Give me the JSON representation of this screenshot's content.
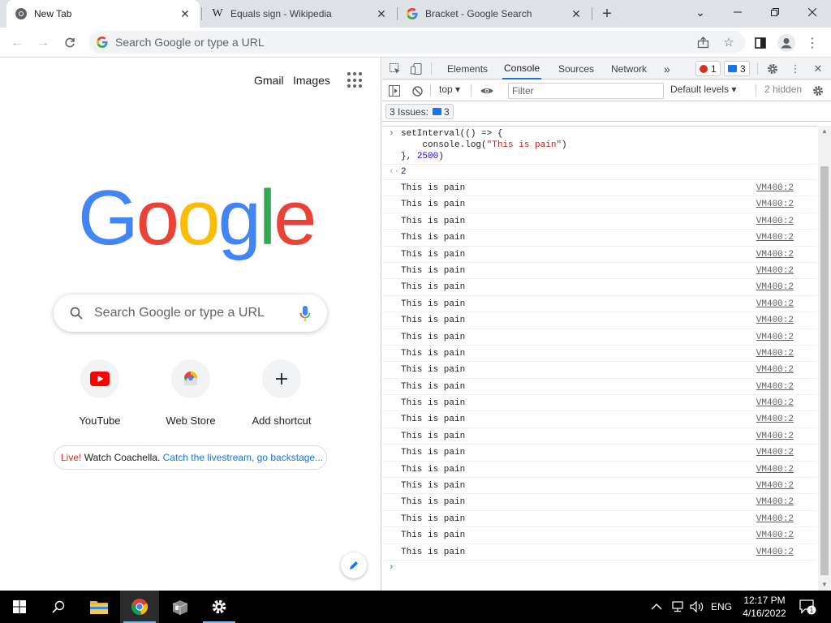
{
  "tabs": [
    {
      "title": "New Tab",
      "icon": "chrome-icon",
      "active": true
    },
    {
      "title": "Equals sign - Wikipedia",
      "icon": "wikipedia-icon",
      "active": false
    },
    {
      "title": "Bracket - Google Search",
      "icon": "google-icon",
      "active": false
    }
  ],
  "omnibox": {
    "placeholder": "Search Google or type a URL"
  },
  "ntp": {
    "gmail": "Gmail",
    "images": "Images",
    "logo_letters": [
      "G",
      "o",
      "o",
      "g",
      "l",
      "e"
    ],
    "logo_colors": [
      "#4285f4",
      "#ea4335",
      "#fbbc05",
      "#4285f4",
      "#34a853",
      "#ea4335"
    ],
    "search_placeholder": "Search Google or type a URL",
    "shortcuts": [
      {
        "label": "YouTube",
        "icon": "youtube-icon"
      },
      {
        "label": "Web Store",
        "icon": "web-store-icon"
      },
      {
        "label": "Add shortcut",
        "icon": "plus-icon"
      }
    ],
    "promo": {
      "live": "Live!",
      "text": " Watch Coachella. ",
      "link": "Catch the livestream, go backstage..."
    }
  },
  "devtools": {
    "tabs": [
      "Elements",
      "Console",
      "Sources",
      "Network"
    ],
    "active_tab": "Console",
    "error_count": "1",
    "message_count": "3",
    "context": "top",
    "filter_placeholder": "Filter",
    "levels": "Default levels",
    "hidden": "2 hidden",
    "issues_label": "3 Issues:",
    "issues_count": "3",
    "input_code": {
      "line1": "setInterval(() => {",
      "line2_pre": "    console.log(",
      "line2_str": "\"This is pain\"",
      "line2_post": ")",
      "line3_pre": "}, ",
      "line3_num": "2500",
      "line3_post": ")"
    },
    "result": "2",
    "log_message": "This is pain",
    "log_source": "VM400:2",
    "log_count": 23
  },
  "taskbar": {
    "time": "12:17 PM",
    "date": "4/16/2022",
    "language": "ENG",
    "notification_count": "1"
  }
}
